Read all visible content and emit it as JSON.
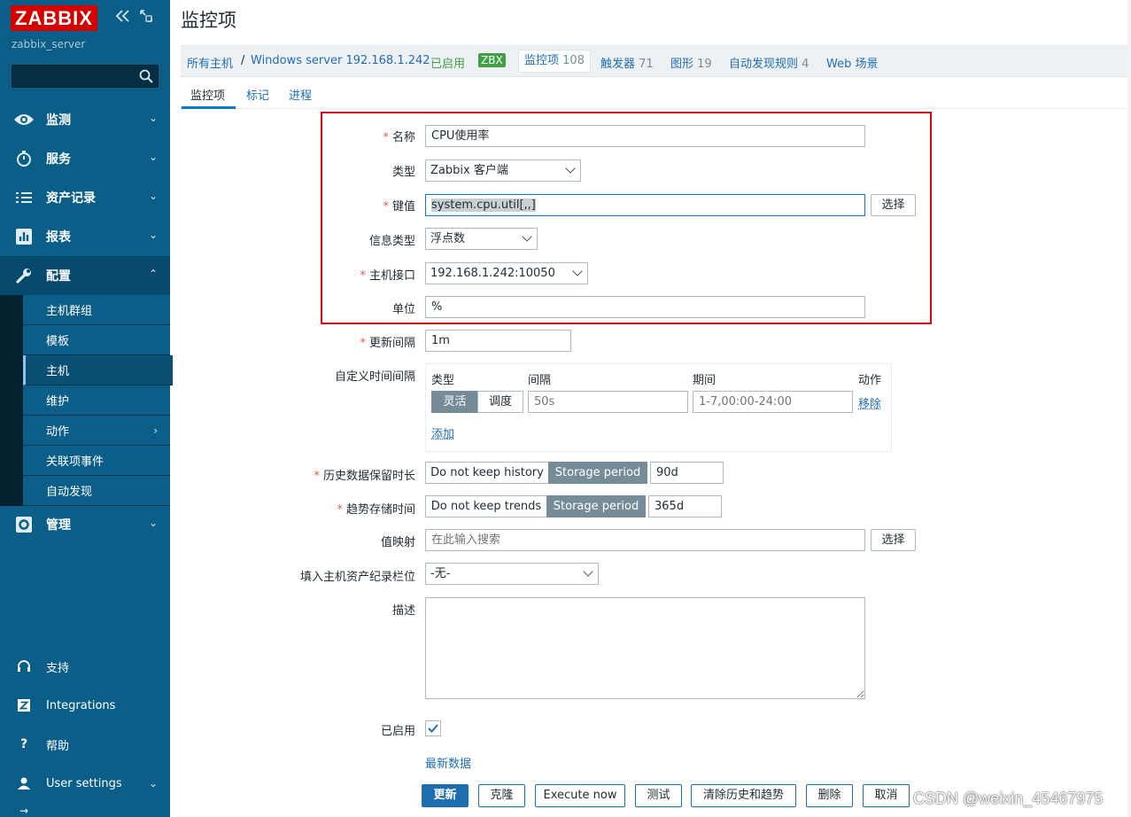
{
  "sidebar": {
    "logo": "ZABBIX",
    "server_name": "zabbix_server",
    "search_icon": "search-icon",
    "menu": [
      {
        "label": "监测",
        "icon": "eye-icon"
      },
      {
        "label": "服务",
        "icon": "stopwatch-icon"
      },
      {
        "label": "资产记录",
        "icon": "list-icon"
      },
      {
        "label": "报表",
        "icon": "bar-chart-icon"
      },
      {
        "label": "配置",
        "icon": "wrench-icon"
      },
      {
        "label": "管理",
        "icon": "gear-icon"
      }
    ],
    "submenu": [
      "主机群组",
      "模板",
      "主机",
      "维护",
      "动作",
      "关联项事件",
      "自动发现"
    ],
    "bottom": [
      {
        "label": "支持",
        "icon": "headset-icon"
      },
      {
        "label": "Integrations",
        "icon": "z-icon"
      },
      {
        "label": "帮助",
        "icon": "question-icon"
      },
      {
        "label": "User settings",
        "icon": "user-icon"
      }
    ],
    "bottom_partial": "→"
  },
  "header": {
    "title": "监控项"
  },
  "host_nav": {
    "all_hosts": "所有主机",
    "separator": "/",
    "host": "Windows server 192.168.1.242",
    "enabled": "已启用",
    "badge": "ZBX",
    "items_label": "监控项",
    "items_count": "108",
    "triggers_label": "触发器",
    "triggers_count": "71",
    "graphs_label": "图形",
    "graphs_count": "19",
    "discovery_label": "自动发现规则",
    "discovery_count": "4",
    "web_label": "Web 场景"
  },
  "tabs": [
    "监控项",
    "标记",
    "进程"
  ],
  "form": {
    "name_label": "名称",
    "name_value": "CPU使用率",
    "type_label": "类型",
    "type_value": "Zabbix 客户端",
    "key_label": "键值",
    "key_value": "system.cpu.util[,,]",
    "select_label": "选择",
    "info_type_label": "信息类型",
    "info_type_value": "浮点数",
    "interface_label": "主机接口",
    "interface_value": "192.168.1.242:10050",
    "unit_label": "单位",
    "unit_value": "%",
    "interval_label": "更新间隔",
    "interval_value": "1m",
    "custom_interval_label": "自定义时间间隔",
    "ci_headers": [
      "类型",
      "间隔",
      "期间",
      "动作"
    ],
    "ci_flexible": "灵活",
    "ci_scheduling": "调度",
    "ci_interval_placeholder": "50s",
    "ci_period_placeholder": "1-7,00:00-24:00",
    "ci_remove": "移除",
    "ci_add": "添加",
    "history_label": "历史数据保留时长",
    "history_no_keep": "Do not keep history",
    "history_storage": "Storage period",
    "history_value": "90d",
    "trends_label": "趋势存储时间",
    "trends_no_keep": "Do not keep trends",
    "trends_storage": "Storage period",
    "trends_value": "365d",
    "valuemap_label": "值映射",
    "valuemap_placeholder": "在此输入搜索",
    "inventory_label": "填入主机资产纪录栏位",
    "inventory_value": "-无-",
    "description_label": "描述",
    "enabled_label": "已启用",
    "enabled_checked": true,
    "latest_data": "最新数据"
  },
  "buttons": [
    "更新",
    "克隆",
    "Execute now",
    "测试",
    "清除历史和趋势",
    "删除",
    "取消"
  ],
  "watermark": "CSDN @weixin_45467975",
  "colors": {
    "sidebar": "#0b5e88",
    "logo": "#d40000",
    "link": "#1f6db1",
    "enabled": "#429e47",
    "highlight_box": "#d20a17"
  }
}
